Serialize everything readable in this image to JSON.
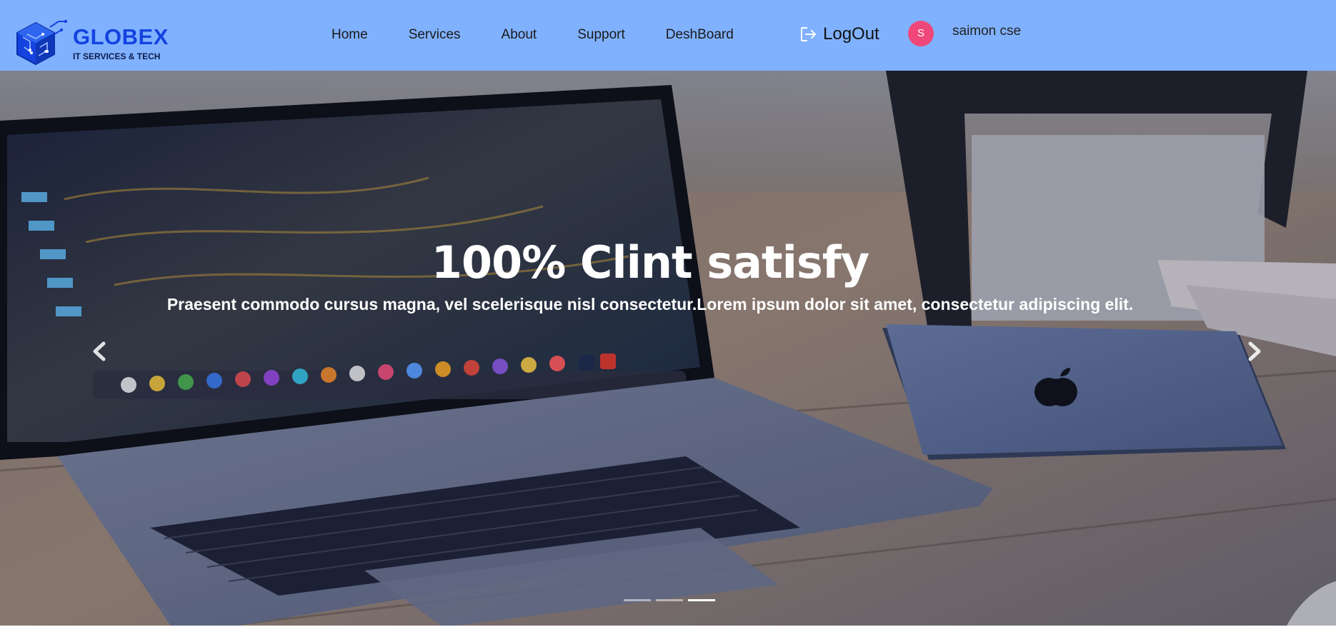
{
  "brand": {
    "name": "GLOBEX",
    "tagline": "IT SERVICES & TECH",
    "icon": "hex-circuit-logo",
    "color": "#1443e0"
  },
  "nav": {
    "background": "#80b1ff",
    "links": [
      {
        "label": "Home"
      },
      {
        "label": "Services"
      },
      {
        "label": "About"
      },
      {
        "label": "Support"
      },
      {
        "label": "DeshBoard"
      }
    ],
    "logout": {
      "label": "LogOut",
      "icon": "logout-icon"
    },
    "user": {
      "initial": "S",
      "name": "saimon cse",
      "avatar_color": "#ef4779"
    }
  },
  "hero": {
    "title": "100% Clint satisfy",
    "subtitle": "Praesent commodo cursus magna, vel scelerisque nisl consectetur.Lorem ipsum dolor sit amet, consectetur adipiscing elit.",
    "prev_icon": "chevron-left-icon",
    "next_icon": "chevron-right-icon",
    "slides_total": 3,
    "active_slide": 3
  }
}
